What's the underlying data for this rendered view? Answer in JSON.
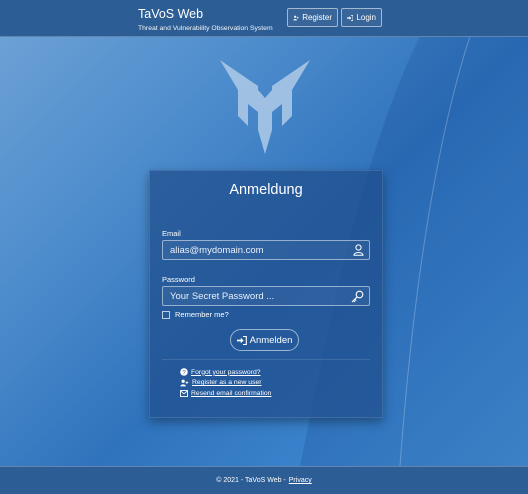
{
  "header": {
    "title": "TaVoS Web",
    "subtitle": "Threat and Vulnerability Observation System",
    "register_label": "Register",
    "login_label": "Login"
  },
  "login": {
    "title": "Anmeldung",
    "email_label": "Email",
    "email_placeholder": "alias@mydomain.com",
    "password_label": "Password",
    "password_placeholder": "Your Secret Password ...",
    "remember_label": "Remember me?",
    "remember_checked": false,
    "submit_label": "Anmelden"
  },
  "links": {
    "forgot": "Forgot your password?",
    "register": "Register as a new user",
    "resend": "Resend email confirmation"
  },
  "footer": {
    "copyright": "© 2021 - TaVoS Web -",
    "privacy": "Privacy"
  },
  "icons": {
    "user_plus": "user-plus-icon",
    "login": "sign-in-icon",
    "user": "user-icon",
    "key": "key-icon",
    "question": "question-circle-icon",
    "envelope": "envelope-icon"
  },
  "colors": {
    "header_bg": "#2c5d94",
    "card_bg": "#1e4e8c",
    "logo": "#a9c7e6"
  }
}
